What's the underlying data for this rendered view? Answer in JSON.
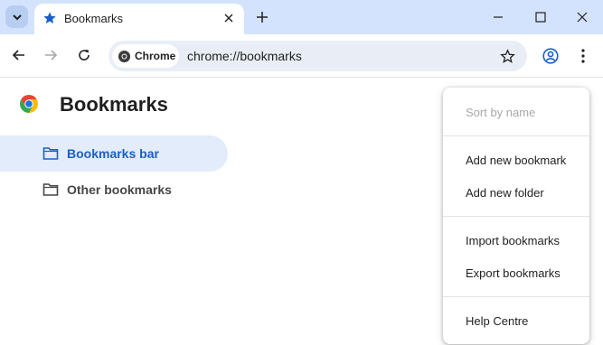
{
  "tab": {
    "title": "Bookmarks"
  },
  "omnibox": {
    "chip_label": "Chrome",
    "url": "chrome://bookmarks"
  },
  "page": {
    "title": "Bookmarks"
  },
  "sidebar": {
    "items": [
      {
        "label": "Bookmarks bar",
        "active": true
      },
      {
        "label": "Other bookmarks",
        "active": false
      }
    ]
  },
  "menu": {
    "items": [
      {
        "label": "Sort by name",
        "disabled": true
      },
      {
        "label": "Add new bookmark",
        "disabled": false
      },
      {
        "label": "Add new folder",
        "disabled": false
      },
      {
        "label": "Import bookmarks",
        "disabled": false
      },
      {
        "label": "Export bookmarks",
        "disabled": false
      },
      {
        "label": "Help Centre",
        "disabled": false
      }
    ]
  },
  "icons": {
    "tab_search": "chevron-down-icon",
    "tab_favicon": "star-icon",
    "back": "back-arrow-icon",
    "forward": "forward-arrow-icon",
    "reload": "reload-icon",
    "bookmark_star": "star-outline-icon",
    "profile": "profile-icon",
    "more": "kebab-menu-icon"
  },
  "colors": {
    "tabstrip": "#d3e3fd",
    "accent": "#1a5fc8",
    "active_item_bg": "#e3ecfb"
  }
}
